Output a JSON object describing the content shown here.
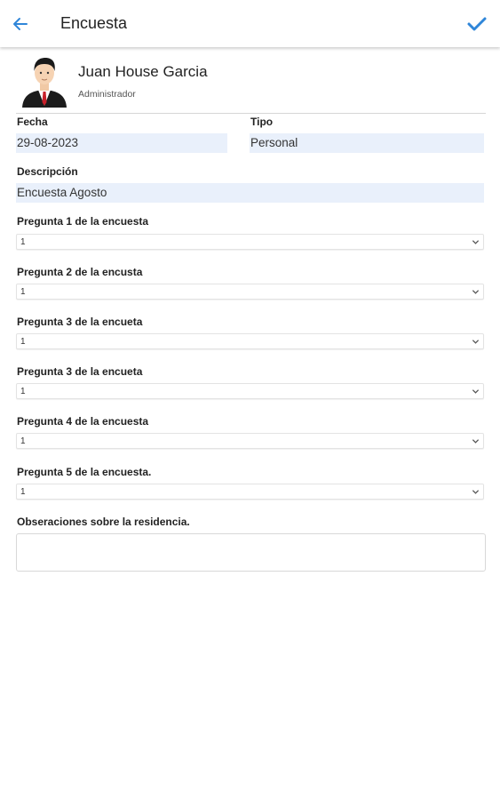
{
  "header": {
    "title": "Encuesta",
    "back_icon": "arrow-left-icon",
    "confirm_icon": "check-icon",
    "accent_color": "#2f86d9"
  },
  "user": {
    "name": "Juan House Garcia",
    "role": "Administrador"
  },
  "form": {
    "fecha_label": "Fecha",
    "fecha_value": "29-08-2023",
    "tipo_label": "Tipo",
    "tipo_value": "Personal",
    "descripcion_label": "Descripción",
    "descripcion_value": "Encuesta Agosto",
    "questions": [
      {
        "label": "Pregunta 1 de la encuesta",
        "value": "1"
      },
      {
        "label": "Pregunta 2 de la encusta",
        "value": "1"
      },
      {
        "label": "Pregunta 3 de la encueta",
        "value": "1"
      },
      {
        "label": "Pregunta 3 de la encueta",
        "value": "1"
      },
      {
        "label": "Pregunta 4 de la encuesta",
        "value": "1"
      },
      {
        "label": "Pregunta 5 de la encuesta.",
        "value": "1"
      }
    ],
    "observaciones_label": "Obseraciones sobre la residencia.",
    "observaciones_value": ""
  }
}
